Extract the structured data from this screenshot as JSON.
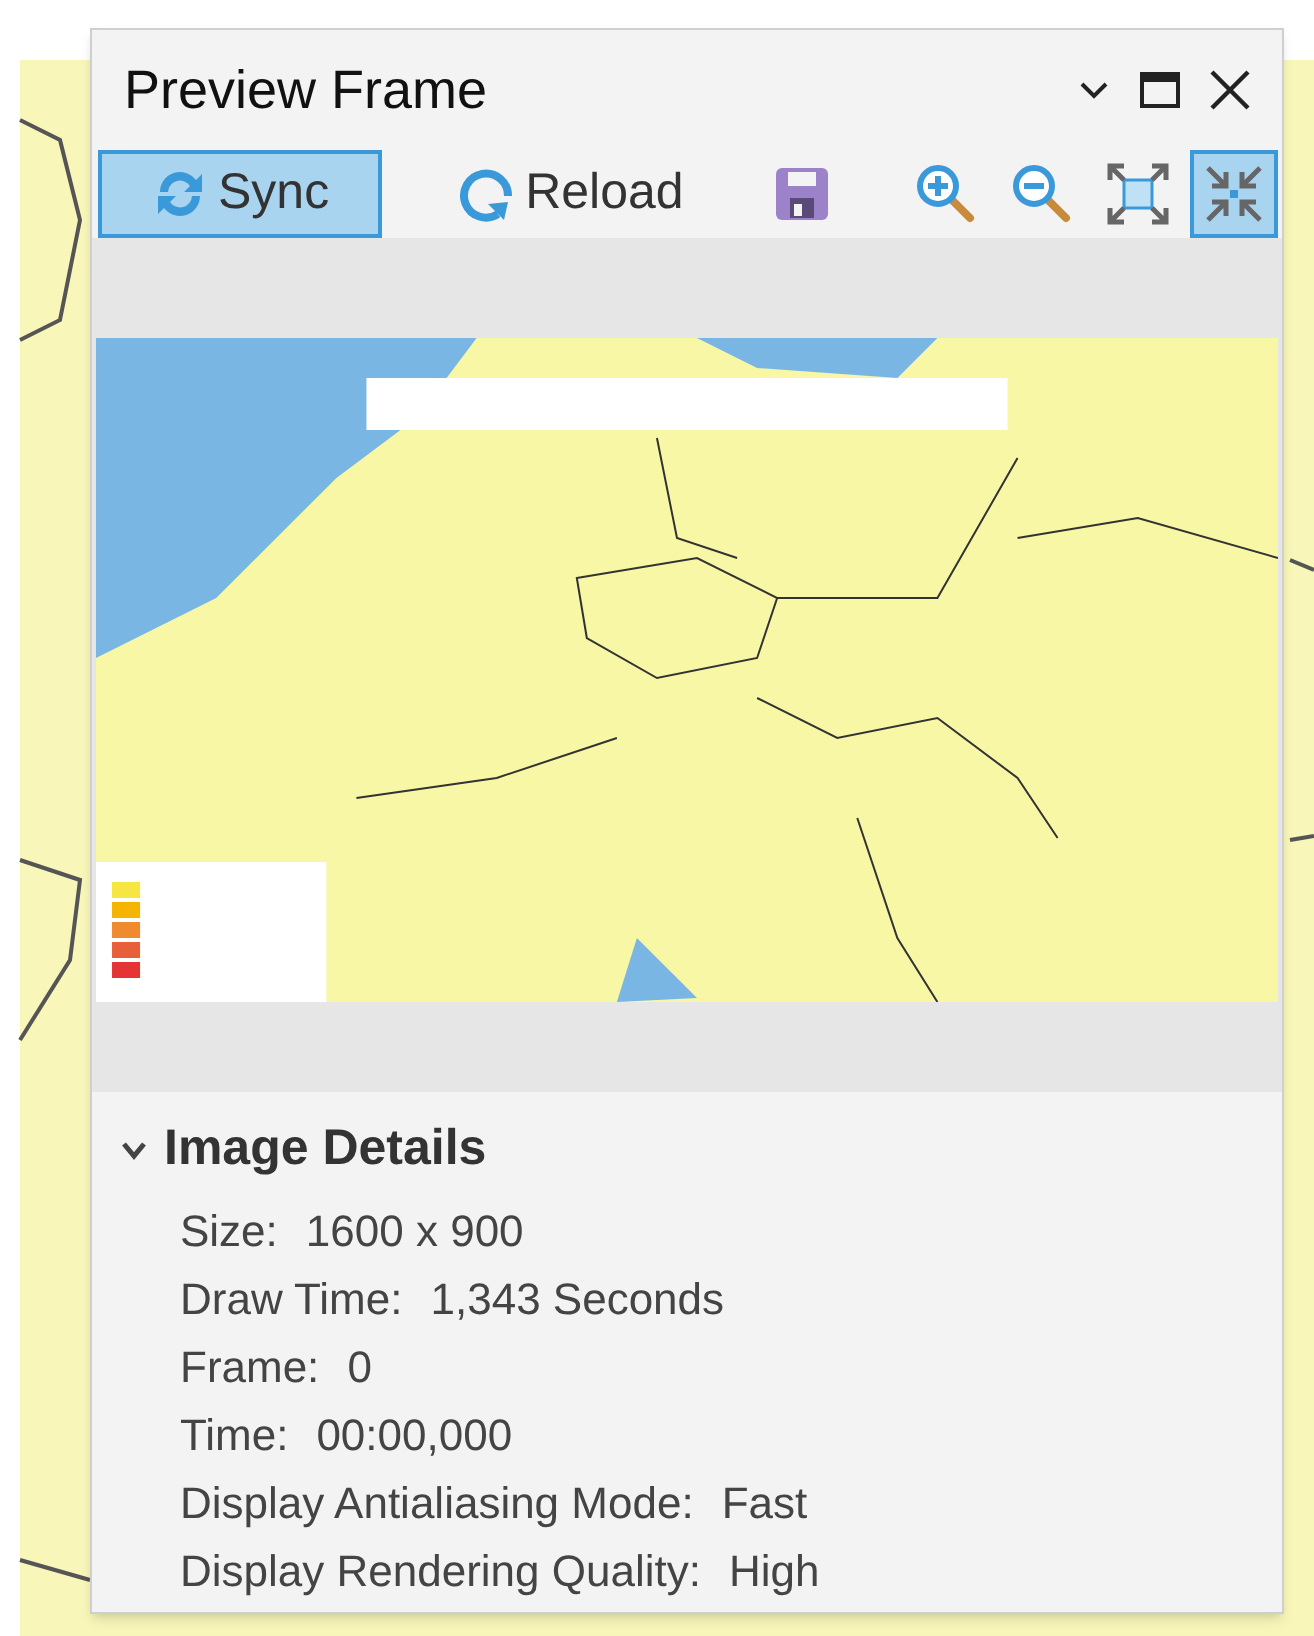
{
  "window": {
    "title": "Preview Frame"
  },
  "toolbar": [
    {
      "kind": "sync",
      "label": "Sync",
      "selected": true
    },
    {
      "kind": "reload",
      "label": "Reload",
      "selected": false
    },
    {
      "kind": "save",
      "selected": false
    },
    {
      "kind": "zoom-in",
      "selected": false
    },
    {
      "kind": "zoom-out",
      "selected": false
    },
    {
      "kind": "full-extent",
      "selected": false
    },
    {
      "kind": "fixed-extent",
      "selected": true
    }
  ],
  "details": {
    "title": "Image Details",
    "expanded": true,
    "fields": [
      {
        "label": "Size:",
        "value": "1600 x 900"
      },
      {
        "label": "Draw Time:",
        "value": "1,343 Seconds"
      },
      {
        "label": "Frame:",
        "value": "0"
      },
      {
        "label": "Time:",
        "value": "00:00,000"
      },
      {
        "label": "Display Antialiasing Mode:",
        "value": "Fast"
      },
      {
        "label": "Display Rendering Quality:",
        "value": "High"
      }
    ]
  }
}
